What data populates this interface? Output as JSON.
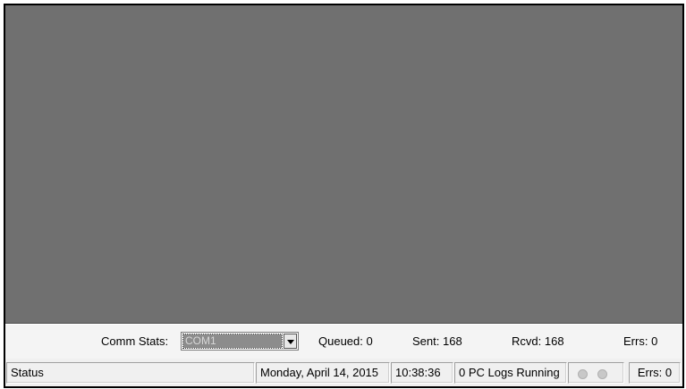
{
  "comm_stats": {
    "label": "Comm Stats:",
    "port_value": "COM1",
    "queued_label": "Queued:",
    "queued_value": "0",
    "sent_label": "Sent:",
    "sent_value": "168",
    "rcvd_label": "Rcvd:",
    "rcvd_value": "168",
    "errs_label": "Errs:",
    "errs_value": "0"
  },
  "status_bar": {
    "status_text": "Status",
    "date": "Monday, April 14, 2015",
    "time": "10:38:36",
    "logs_running": "0 PC Logs Running",
    "indicators": [
      "led-icon",
      "led-icon"
    ],
    "errs": "Errs: 0"
  },
  "colors": {
    "workspace": "#707070",
    "bar_background": "#f0f0f0",
    "selection": "#8c8c8c"
  }
}
